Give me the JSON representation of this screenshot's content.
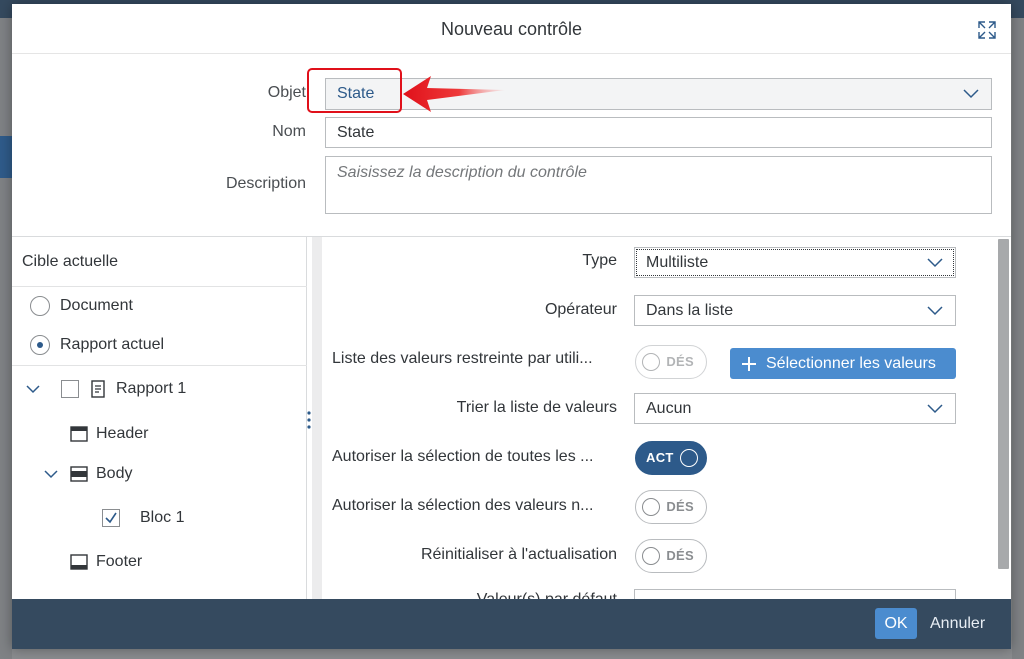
{
  "dialog": {
    "title": "Nouveau contrôle",
    "expand_icon": "expand-icon"
  },
  "form": {
    "objet_label": "Objet",
    "objet_value": "State",
    "nom_label": "Nom",
    "nom_value": "State",
    "description_label": "Description",
    "description_placeholder": "Saisissez la description du contrôle"
  },
  "annotation": {
    "highlight_color": "#e0101a",
    "arrow_color": "#e0101a"
  },
  "target_panel": {
    "title": "Cible actuelle",
    "radio_document": "Document",
    "radio_rapport": "Rapport actuel",
    "selected": "Rapport actuel",
    "tree": {
      "rapport": "Rapport 1",
      "header": "Header",
      "body": "Body",
      "bloc": "Bloc 1",
      "footer": "Footer"
    }
  },
  "settings": {
    "type_label": "Type",
    "type_value": "Multiliste",
    "operateur_label": "Opérateur",
    "operateur_value": "Dans la liste",
    "restricted_label": "Liste des valeurs restreinte par utili...",
    "restricted_state": "DÉS",
    "select_values_button": "Sélectionner les valeurs",
    "sort_label": "Trier la liste de valeurs",
    "sort_value": "Aucun",
    "allow_all_label": "Autoriser la sélection de toutes les ...",
    "allow_all_state": "ACT",
    "allow_not_label": "Autoriser la sélection des valeurs n...",
    "allow_not_state": "DÉS",
    "reset_label": "Réinitialiser à l'actualisation",
    "reset_state": "DÉS",
    "default_label": "Valeur(s) par défaut"
  },
  "footer": {
    "ok": "OK",
    "cancel": "Annuler"
  },
  "colors": {
    "accent": "#4b8ccf",
    "footer_bg": "#354a5f",
    "switch_on": "#2d5a8a"
  }
}
